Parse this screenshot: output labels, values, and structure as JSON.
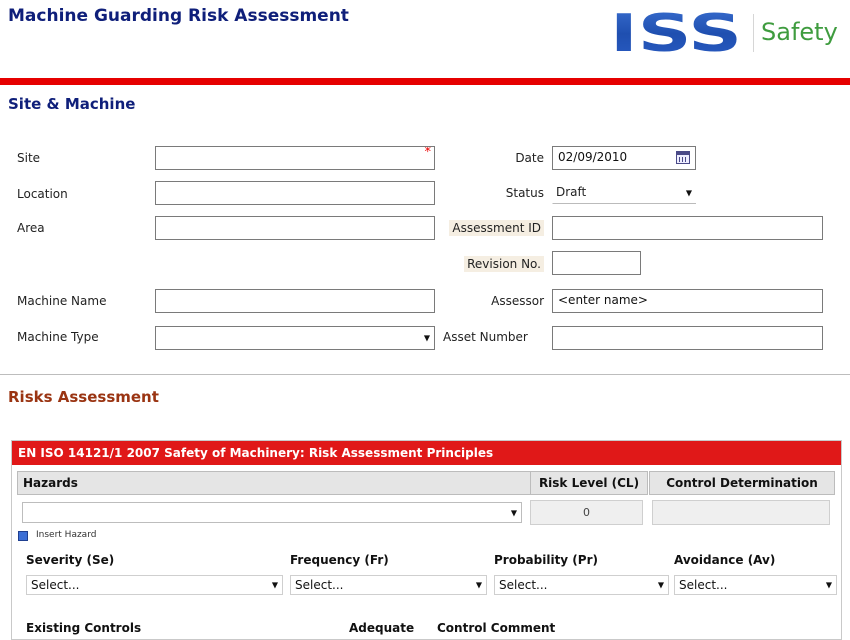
{
  "header": {
    "title": "Machine Guarding Risk Assessment",
    "logo": {
      "brand": "ISS",
      "product": "Safety",
      "brand_color": "#1f4fb0",
      "product_color": "#3f9c3f"
    }
  },
  "site_section": {
    "heading": "Site & Machine",
    "labels": {
      "site": "Site",
      "location": "Location",
      "area": "Area",
      "machine_name": "Machine Name",
      "machine_type": "Machine Type",
      "date": "Date",
      "status": "Status",
      "assessment_id": "Assessment ID",
      "revision_no": "Revision No.",
      "assessor": "Assessor",
      "asset_number": "Asset Number"
    },
    "values": {
      "site": "",
      "location": "",
      "area": "",
      "machine_name": "",
      "machine_type": "",
      "date": "02/09/2010",
      "status": "Draft",
      "assessment_id": "",
      "revision_no": "",
      "assessor": "<enter name>",
      "asset_number": ""
    },
    "required_marker": "*"
  },
  "risks_section": {
    "heading": "Risks Assessment",
    "panel_title": "EN ISO 14121/1 2007 Safety of Machinery: Risk Assessment Principles",
    "columns": {
      "hazards": "Hazards",
      "risk_level": "Risk Level (CL)",
      "control_determination": "Control Determination"
    },
    "risk_level_value": "0",
    "insert_hazard": "Insert Hazard",
    "factors": [
      {
        "label": "Severity (Se)",
        "value": "Select..."
      },
      {
        "label": "Frequency (Fr)",
        "value": "Select..."
      },
      {
        "label": "Probability (Pr)",
        "value": "Select..."
      },
      {
        "label": "Avoidance (Av)",
        "value": "Select..."
      }
    ],
    "controls_headers": {
      "existing_controls": "Existing Controls",
      "adequate": "Adequate",
      "control_comment": "Control Comment"
    }
  },
  "colors": {
    "title": "#0f1f7a",
    "accent_bar": "#e60000",
    "risks_heading": "#9a3412",
    "panel_header": "#e01818"
  }
}
